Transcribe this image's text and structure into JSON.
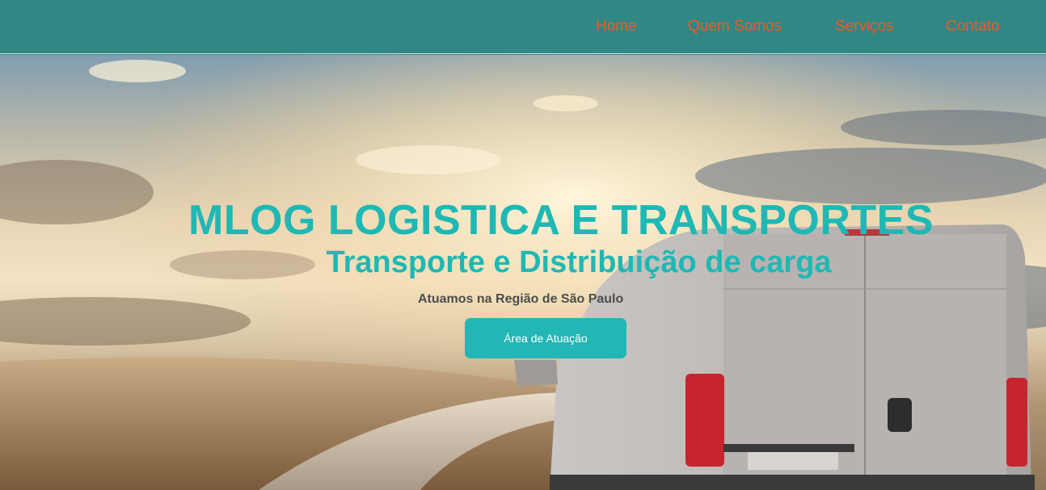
{
  "nav": {
    "items": [
      {
        "label": "Home"
      },
      {
        "label": "Quem Somos"
      },
      {
        "label": "Serviços"
      },
      {
        "label": "Contato"
      }
    ]
  },
  "hero": {
    "title": "MLOG LOGISTICA E TRANSPORTES",
    "subtitle": "Transporte e Distribuição de carga",
    "region_text": "Atuamos na Região de São Paulo",
    "cta_label": "Área de Atuação"
  },
  "colors": {
    "topbar": "#308784",
    "nav_link": "#f05a24",
    "heading": "#1fb8b4",
    "cta": "#22b6b4"
  }
}
